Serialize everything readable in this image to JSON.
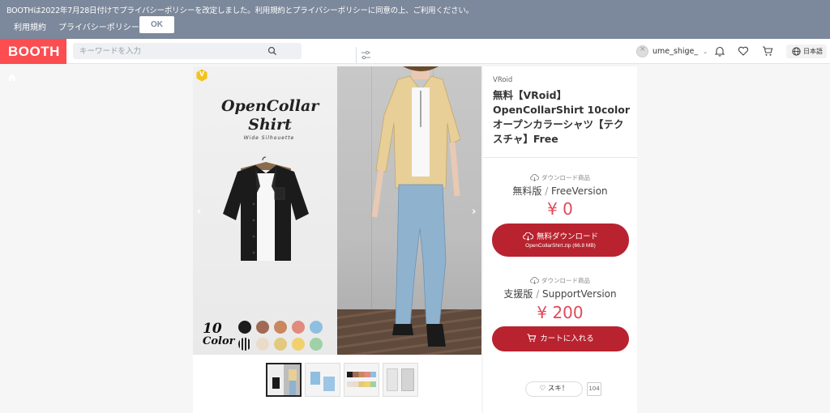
{
  "notice": {
    "text": "BOOTHは2022年7月28日付けでプライバシーポリシーを改定しました。利用規約とプライバシーポリシーに同意の上、ご利用ください。",
    "terms_link": "利用規約",
    "privacy_link": "プライバシーポリシー",
    "ok_button": "OK"
  },
  "header": {
    "logo": "BOOTH",
    "search_placeholder": "キーワードを入力",
    "username": "ume_shige_",
    "language": "日本語",
    "icons": [
      "search-icon",
      "filter-icon",
      "bell-icon",
      "heart-icon",
      "cart-icon",
      "globe-icon"
    ]
  },
  "gallery": {
    "image_title_line1": "OpenCollar",
    "image_title_line2": "Shirt",
    "image_subtitle": "Wide Silhouette",
    "color_count": "10",
    "color_label": "Color",
    "badge": "V",
    "swatches": [
      "#1c1c1c",
      "#a06a55",
      "#c9875f",
      "#e38a7e",
      "#8fbfe0",
      "#e8e0d6",
      "#eadccb",
      "#e3c880",
      "#f1d070",
      "#9fd0a6"
    ],
    "thumbnail_count": 4
  },
  "product": {
    "category": "VRoid",
    "title": "無料【VRoid】OpenCollarShirt 10color オープンカラーシャツ【テクスチャ】Free",
    "free": {
      "type_label": "ダウンロード商品",
      "variation_name": "無料版",
      "variation_en": "FreeVersion",
      "price": "¥ 0",
      "button_label": "無料ダウンロード",
      "button_file": "OpenCollarShirt.zip (66.8 MB)"
    },
    "support": {
      "type_label": "ダウンロード商品",
      "variation_name": "支援版",
      "variation_en": "SupportVersion",
      "price": "¥ 200",
      "button_label": "カートに入れる"
    },
    "like_label": "スキ！",
    "like_count": "104"
  },
  "colors": {
    "brand": "#fc4d50",
    "notice_bg": "#7c889b",
    "button": "#b8232f",
    "price": "#e0495a"
  }
}
